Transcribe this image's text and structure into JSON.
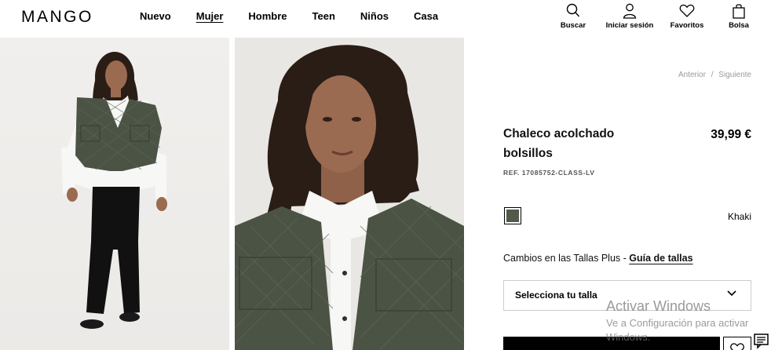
{
  "header": {
    "logo": "MANGO",
    "nav": [
      "Nuevo",
      "Mujer",
      "Hombre",
      "Teen",
      "Niños",
      "Casa"
    ],
    "active_nav": "Mujer",
    "actions": {
      "search": "Buscar",
      "login": "Iniciar sesión",
      "favorites": "Favoritos",
      "bag": "Bolsa"
    }
  },
  "product": {
    "pager_prev": "Anterior",
    "pager_sep": "/",
    "pager_next": "Siguiente",
    "title": "Chaleco acolchado bolsillos",
    "price": "39,99 €",
    "ref": "REF. 17085752-CLASS-LV",
    "color": {
      "name": "Khaki",
      "hex": "#525a4b"
    },
    "sizes_text": "Cambios en las Tallas Plus - ",
    "size_guide": "Guía de tallas",
    "size_select": "Selecciona tu talla"
  },
  "watermark": {
    "line1": "Activar Windows",
    "line2": "Ve a Configuración para activar Windows."
  },
  "colors": {
    "vest": "#4b5345",
    "shirt": "#f7f7f5",
    "pants": "#111111",
    "hair": "#2a1d16",
    "skin": "#9a6b50"
  }
}
